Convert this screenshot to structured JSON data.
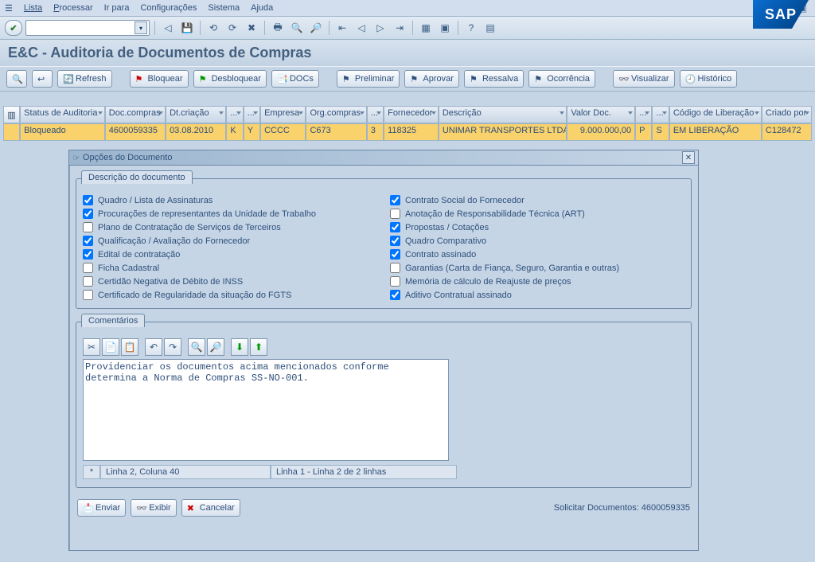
{
  "menu": {
    "items": [
      "Lista",
      "Processar",
      "Ir para",
      "Configurações",
      "Sistema",
      "Ajuda"
    ]
  },
  "page_title": "E&C - Auditoria de Documentos de Compras",
  "action_buttons": {
    "refresh": "Refresh",
    "bloquear": "Bloquear",
    "desbloquear": "Desbloquear",
    "docs": "DOCs",
    "preliminar": "Preliminar",
    "aprovar": "Aprovar",
    "ressalva": "Ressalva",
    "ocorrencia": "Ocorrência",
    "visualizar": "Visualizar",
    "historico": "Histórico"
  },
  "grid": {
    "headers": [
      "Status de Auditoria",
      "Doc.compras",
      "Dt.criação",
      "...",
      "...",
      "Empresa",
      "Org.compras",
      "...",
      "Fornecedor",
      "Descrição",
      "Valor Doc.",
      "...",
      "...",
      "Código de Liberação",
      "Criado por"
    ],
    "row": [
      "Bloqueado",
      "4600059335",
      "03.08.2010",
      "K",
      "Y",
      "CCCC",
      "C673",
      "3",
      "118325",
      "UNIMAR TRANSPORTES LTDA.",
      "9.000.000,00",
      "P",
      "S",
      "EM LIBERAÇÃO",
      "C128472"
    ]
  },
  "dialog": {
    "title": "Opções do Documento",
    "panel_title": "Descrição do documento",
    "checks": [
      {
        "label": "Quadro / Lista de Assinaturas",
        "checked": true
      },
      {
        "label": "Contrato Social do Fornecedor",
        "checked": true
      },
      {
        "label": "Procurações de representantes da Unidade de Trabalho",
        "checked": true
      },
      {
        "label": "Anotação de Responsabilidade Técnica (ART)",
        "checked": false
      },
      {
        "label": "Plano de Contratação de Serviços de Terceiros",
        "checked": false
      },
      {
        "label": "Propostas / Cotações",
        "checked": true
      },
      {
        "label": "Qualificação / Avaliação do Fornecedor",
        "checked": true
      },
      {
        "label": "Quadro Comparativo",
        "checked": true
      },
      {
        "label": "Edital de contratação",
        "checked": true
      },
      {
        "label": "Contrato assinado",
        "checked": true
      },
      {
        "label": "Ficha Cadastral",
        "checked": false
      },
      {
        "label": "Garantias (Carta de Fiança, Seguro, Garantia e outras)",
        "checked": false
      },
      {
        "label": "Certidão Negativa de Débito de INSS",
        "checked": false
      },
      {
        "label": "Memória de cálculo de Reajuste de preços",
        "checked": false
      },
      {
        "label": "Certificado de Regularidade da situação do FGTS",
        "checked": false
      },
      {
        "label": "Aditivo Contratual assinado",
        "checked": true
      }
    ],
    "comments_title": "Comentários",
    "comments_text": "Providenciar os documentos acima mencionados conforme\ndetermina a Norma de Compras SS-NO-001.",
    "status_pos": "Linha 2, Coluna 40",
    "status_range": "Linha 1 - Linha 2 de 2 linhas",
    "footer": {
      "enviar": "Enviar",
      "exibir": "Exibir",
      "cancelar": "Cancelar",
      "request": "Solicitar Documentos: 4600059335"
    }
  }
}
